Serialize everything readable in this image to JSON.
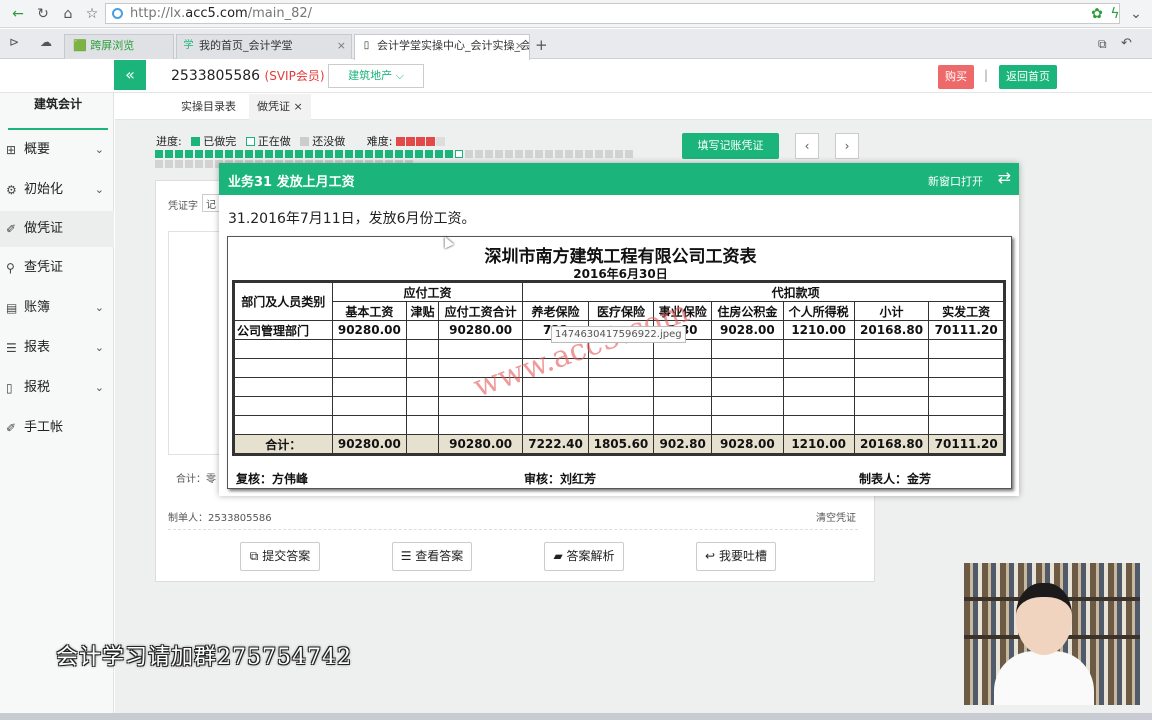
{
  "browser": {
    "url_prefix": "http://lx.",
    "url_domain": "acc5.com",
    "url_path": "/main_82/",
    "tabs": [
      {
        "label": "🟩 跨屏浏览"
      },
      {
        "label": "我的首页_会计学堂"
      },
      {
        "label": "会计学堂实操中心_会计实操_会"
      }
    ]
  },
  "header": {
    "account": "2533805586",
    "vip": "(SVIP会员)",
    "industry": "建筑地产 ⌵",
    "buy": "购买",
    "sep": "|",
    "home": "返回首页"
  },
  "sidebar": {
    "brand": "建筑会计",
    "items": [
      {
        "label": "概要",
        "icon": "grid-icon"
      },
      {
        "label": "初始化",
        "icon": "gear-icon"
      },
      {
        "label": "做凭证",
        "icon": "pen-icon"
      },
      {
        "label": "查凭证",
        "icon": "search-icon"
      },
      {
        "label": "账簿",
        "icon": "book-icon"
      },
      {
        "label": "报表",
        "icon": "list-icon"
      },
      {
        "label": "报税",
        "icon": "file-icon"
      },
      {
        "label": "手工帐",
        "icon": "pen-icon"
      }
    ]
  },
  "subtabs": {
    "t1": "实操目录表",
    "t2": "做凭证",
    "t2_close": "×"
  },
  "progress": {
    "label": "进度:",
    "done": "已做完",
    "doing": "正在做",
    "todo": "还没做",
    "difficulty": "难度:",
    "done_color": "#1bb57c",
    "total_steps": 74,
    "done_steps": 30,
    "difficulty_stars": 4
  },
  "voucher": {
    "fill_button": "填写记账凭证",
    "prev": "‹",
    "next": "›",
    "word_label": "凭证字",
    "word_value": "记",
    "total_label": "合计：零",
    "maker": "制单人：2533805586",
    "clear": "清空凭证",
    "actions": [
      "提交答案",
      "查看答案",
      "答案解析",
      "我要吐槽"
    ]
  },
  "modal": {
    "title": "业务31 发放上月工资",
    "open_new": "新窗口打开",
    "swap": "⇄",
    "desc": "31.2016年7月11日，发放6月份工资。"
  },
  "payroll": {
    "title": "深圳市南方建筑工程有限公司工资表",
    "date": "2016年6月30日",
    "dept_header": "部门及人员类别",
    "group_payable": "应付工资",
    "group_deduct": "代扣款项",
    "columns": [
      "基本工资",
      "津贴",
      "应付工资合计",
      "养老保险",
      "医疗保险",
      "事业保险",
      "住房公积金",
      "个人所得税",
      "小计",
      "实发工资"
    ],
    "row1": {
      "dept": "公司管理部门",
      "values": [
        "90280.00",
        "",
        "90280.00",
        "722",
        "",
        "2.80",
        "9028.00",
        "1210.00",
        "20168.80",
        "70111.20"
      ]
    },
    "total": {
      "label": "合计：",
      "values": [
        "90280.00",
        "",
        "90280.00",
        "7222.40",
        "1805.60",
        "902.80",
        "9028.00",
        "1210.00",
        "20168.80",
        "70111.20"
      ]
    },
    "reviewer": "复核：方伟峰",
    "auditor": "审核：刘红芳",
    "preparer": "制表人：金芳",
    "watermark": "www.acc5.com",
    "tooltip": "1474630417596922.jpeg"
  },
  "caption": "会计学习请加群275754742"
}
